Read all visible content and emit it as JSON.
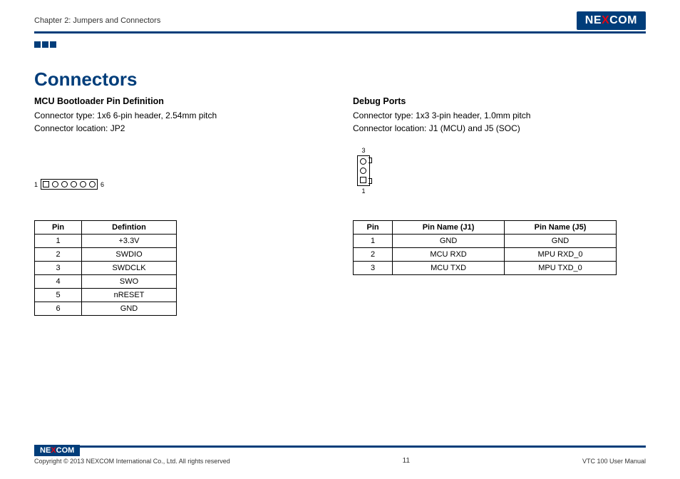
{
  "header": {
    "chapter": "Chapter 2: Jumpers and Connectors",
    "logo_pre": "NE",
    "logo_x": "X",
    "logo_post": "COM"
  },
  "title": "Connectors",
  "left": {
    "heading": "MCU Bootloader Pin Definition",
    "line1": "Connector type: 1x6 6-pin header, 2.54mm pitch",
    "line2": "Connector location: JP2",
    "pin_left": "1",
    "pin_right": "6",
    "th_pin": "Pin",
    "th_def": "Defintion",
    "rows": [
      {
        "pin": "1",
        "def": "+3.3V"
      },
      {
        "pin": "2",
        "def": "SWDIO"
      },
      {
        "pin": "3",
        "def": "SWDCLK"
      },
      {
        "pin": "4",
        "def": "SWO"
      },
      {
        "pin": "5",
        "def": "nRESET"
      },
      {
        "pin": "6",
        "def": "GND"
      }
    ]
  },
  "right": {
    "heading": "Debug Ports",
    "line1": "Connector type: 1x3 3-pin header, 1.0mm pitch",
    "line2": "Connector location: J1 (MCU) and J5 (SOC)",
    "pin_top": "3",
    "pin_bot": "1",
    "th_pin": "Pin",
    "th_j1": "Pin Name (J1)",
    "th_j5": "Pin Name (J5)",
    "rows": [
      {
        "pin": "1",
        "j1": "GND",
        "j5": "GND"
      },
      {
        "pin": "2",
        "j1": "MCU RXD",
        "j5": "MPU RXD_0"
      },
      {
        "pin": "3",
        "j1": "MCU TXD",
        "j5": "MPU TXD_0"
      }
    ]
  },
  "footer": {
    "copyright": "Copyright © 2013 NEXCOM International Co., Ltd. All rights reserved",
    "page": "11",
    "manual": "VTC 100 User Manual"
  },
  "chart_data": [
    {
      "type": "table",
      "title": "MCU Bootloader Pin Definition (JP2)",
      "columns": [
        "Pin",
        "Defintion"
      ],
      "rows": [
        [
          "1",
          "+3.3V"
        ],
        [
          "2",
          "SWDIO"
        ],
        [
          "3",
          "SWDCLK"
        ],
        [
          "4",
          "SWO"
        ],
        [
          "5",
          "nRESET"
        ],
        [
          "6",
          "GND"
        ]
      ]
    },
    {
      "type": "table",
      "title": "Debug Ports (J1 / J5)",
      "columns": [
        "Pin",
        "Pin Name (J1)",
        "Pin Name (J5)"
      ],
      "rows": [
        [
          "1",
          "GND",
          "GND"
        ],
        [
          "2",
          "MCU RXD",
          "MPU RXD_0"
        ],
        [
          "3",
          "MCU TXD",
          "MPU TXD_0"
        ]
      ]
    }
  ]
}
